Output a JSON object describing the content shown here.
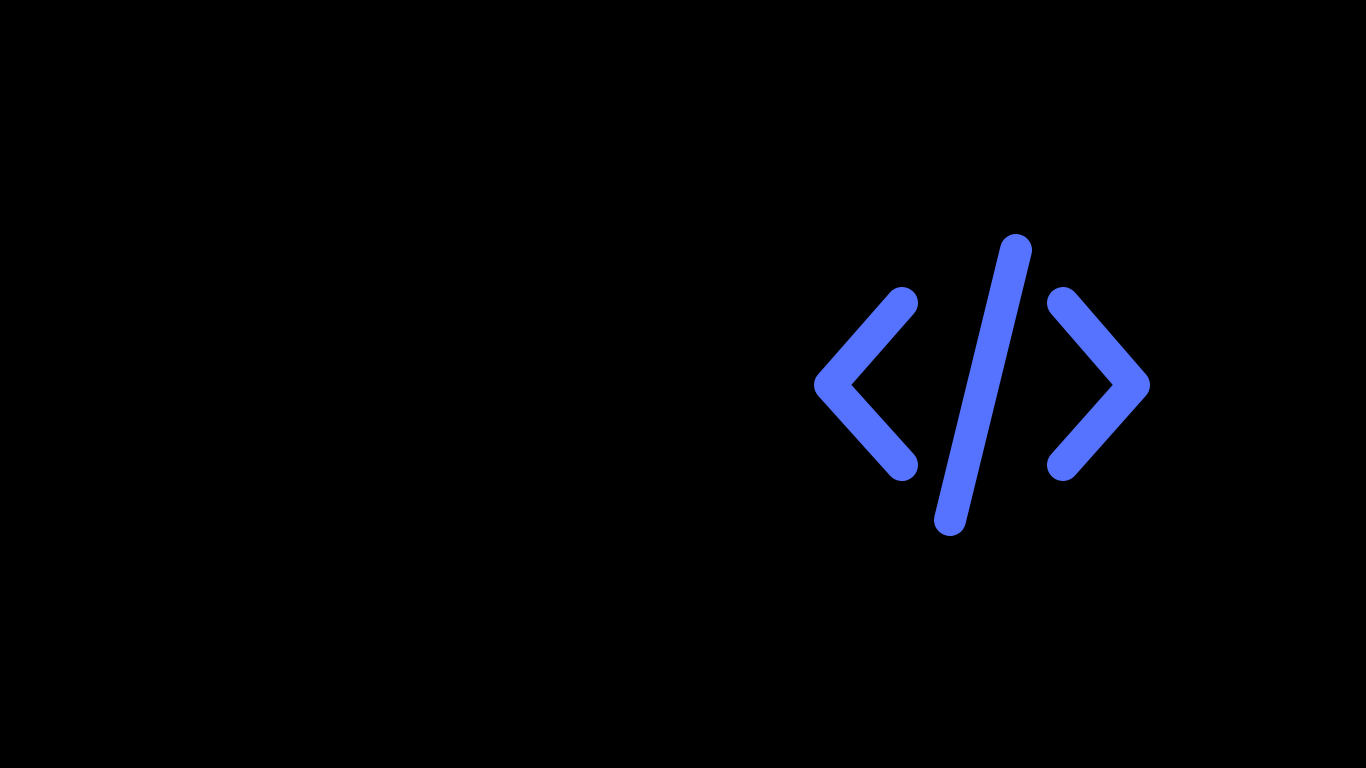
{
  "screen": {
    "background_color": "#000000"
  },
  "icon": {
    "name": "code-icon",
    "color": "#5573FF"
  }
}
